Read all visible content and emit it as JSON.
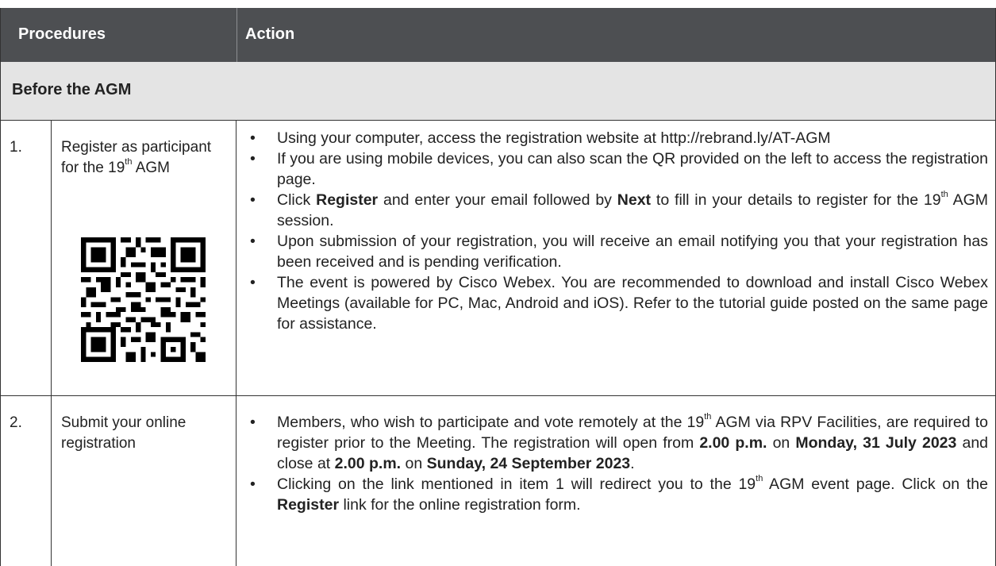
{
  "header": {
    "procedures": "Procedures",
    "action": "Action"
  },
  "section": {
    "title": "Before the AGM"
  },
  "rows": [
    {
      "number": "1.",
      "procedure": {
        "pre": "Register as participant for the 19",
        "sup": "th",
        "post": " AGM"
      },
      "bullets": [
        "Using your computer, access the registration website at http://rebrand.ly/AT-AGM",
        "If you are using mobile devices, you can also scan the QR provided on the left to access the registration page.",
        {
          "a": "Click ",
          "b1": "Register",
          "c": " and enter your email followed by ",
          "b2": "Next",
          "d": " to fill in your details to register for the 19",
          "sup": "th",
          "e": " AGM session."
        },
        "Upon submission of your registration, you will receive an email notifying you that your registration has been received and is pending verification.",
        "The event is powered by Cisco Webex. You are recommended to download and install Cisco Webex Meetings (available for PC, Mac, Android and iOS). Refer to the tutorial guide posted on the same page for assistance."
      ]
    },
    {
      "number": "2.",
      "procedure": {
        "text": "Submit your online registration"
      },
      "bullets": [
        {
          "a": "Members, who wish to participate and vote remotely at the 19",
          "sup": "th",
          "b": " AGM via RPV Facilities, are required to register prior to the Meeting. The registration will open from ",
          "t1": "2.00 p.m.",
          "c": " on ",
          "d1": "Monday, 31 July 2023",
          "e": " and close at ",
          "t2": "2.00 p.m.",
          "f": " on ",
          "d2": "Sunday, 24 September 2023",
          "g": "."
        },
        {
          "a": "Clicking on the link mentioned in item 1 will redirect you to the 19",
          "sup": "th",
          "b": " AGM event page. Click on the ",
          "b1": "Register",
          "c": " link for the online registration form."
        }
      ]
    }
  ]
}
